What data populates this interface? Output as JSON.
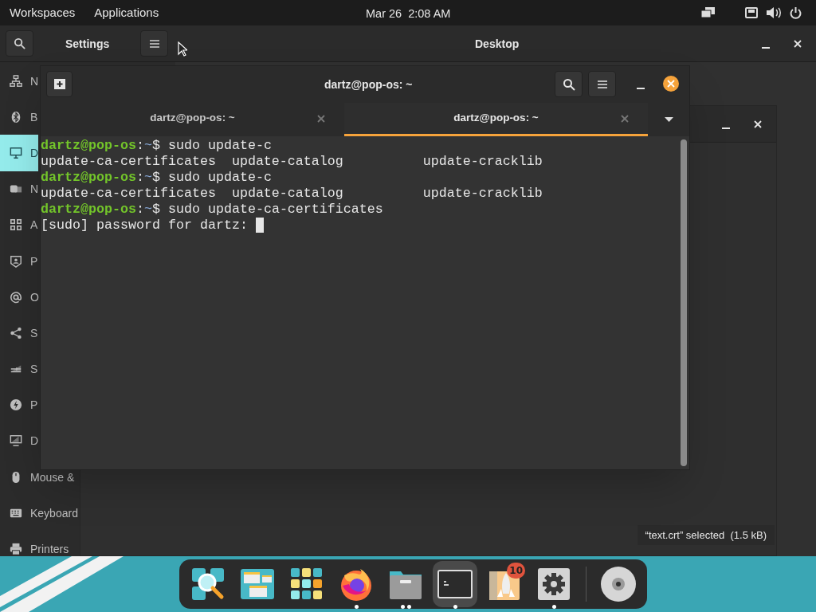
{
  "top_bar": {
    "menus": [
      "Workspaces",
      "Applications"
    ],
    "clock": "Mar 26  2:08 AM"
  },
  "settings_window": {
    "title": "Settings",
    "page_title": "Desktop",
    "sidebar": [
      {
        "label": "N",
        "kind": "network",
        "selected": false
      },
      {
        "label": "B",
        "kind": "bluetooth",
        "selected": false
      },
      {
        "label": "D",
        "kind": "desktop",
        "selected": true
      },
      {
        "label": "N",
        "kind": "notifications",
        "selected": false
      },
      {
        "label": "A",
        "kind": "apps",
        "selected": false
      },
      {
        "label": "P",
        "kind": "privacy",
        "selected": false
      },
      {
        "label": "O",
        "kind": "at",
        "selected": false
      },
      {
        "label": "S",
        "kind": "share",
        "selected": false
      },
      {
        "label": "S",
        "kind": "sound",
        "selected": false
      },
      {
        "label": "P",
        "kind": "power",
        "selected": false
      },
      {
        "label": "D",
        "kind": "display",
        "selected": false
      },
      {
        "label": "Mouse &",
        "kind": "mouse",
        "selected": false
      },
      {
        "label": "Keyboard",
        "kind": "keyboard",
        "selected": false
      },
      {
        "label": "Printers",
        "kind": "printer",
        "selected": false
      }
    ]
  },
  "file_window": {
    "status": "“text.crt” selected  (1.5 kB)"
  },
  "terminal": {
    "title": "dartz@pop-os: ~",
    "tabs": [
      {
        "label": "dartz@pop-os: ~",
        "selected": false
      },
      {
        "label": "dartz@pop-os: ~",
        "selected": true
      }
    ],
    "lines": [
      {
        "kind": "prompt",
        "user": "dartz@pop-os",
        "separator": ":",
        "path": "~",
        "command": "$ sudo update-c"
      },
      {
        "kind": "output",
        "text": "update-ca-certificates  update-catalog          update-cracklib"
      },
      {
        "kind": "prompt",
        "user": "dartz@pop-os",
        "separator": ":",
        "path": "~",
        "command": "$ sudo update-c"
      },
      {
        "kind": "output",
        "text": "update-ca-certificates  update-catalog          update-cracklib"
      },
      {
        "kind": "prompt",
        "user": "dartz@pop-os",
        "separator": ":",
        "path": "~",
        "command": "$ sudo update-ca-certificates"
      },
      {
        "kind": "input",
        "text": "[sudo] password for dartz: "
      }
    ]
  },
  "dock": [
    {
      "kind": "search",
      "selected": false
    },
    {
      "kind": "windows",
      "selected": false
    },
    {
      "kind": "grid",
      "selected": false
    },
    {
      "kind": "firefox",
      "windows": [
        {
          "running": true
        }
      ],
      "selected": false
    },
    {
      "kind": "files",
      "windows": [
        {
          "running": true
        },
        {
          "running": true
        }
      ],
      "selected": false
    },
    {
      "kind": "terminal",
      "windows": [
        {
          "running": true
        }
      ],
      "selected": true
    },
    {
      "kind": "launcher",
      "selected": false,
      "badge": "10"
    },
    {
      "kind": "settings",
      "windows": [
        {
          "running": true
        }
      ],
      "selected": false
    },
    {
      "kind": "separator"
    },
    {
      "kind": "disc",
      "selected": false
    }
  ]
}
